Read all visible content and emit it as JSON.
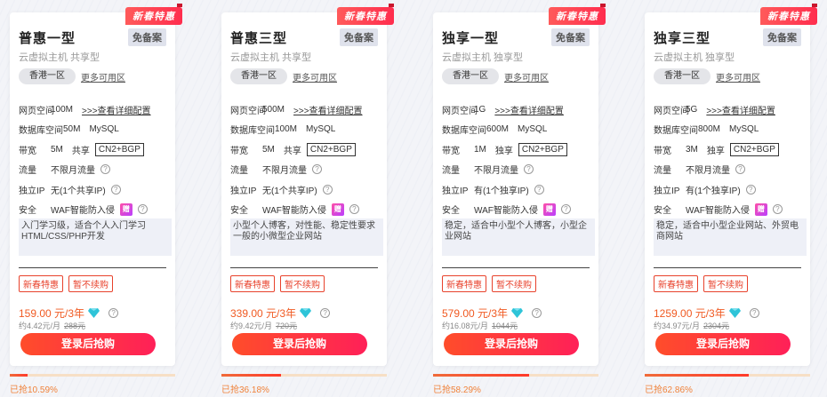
{
  "cards": [
    {
      "badge": "新春特惠",
      "title": "普惠一型",
      "free_tag": "免备案",
      "subtitle": "云虚拟主机 共享型",
      "region": "香港一区",
      "more_region": "更多可用区",
      "web_space_label": "网页空间",
      "web_space": "100M",
      "detail_link": ">>>查看详细配置",
      "db_label": "数据库空间",
      "db_space": "50M",
      "db_type": "MySQL",
      "bw_label": "带宽",
      "bandwidth": "5M",
      "bw_type": "共享",
      "line": "CN2+BGP",
      "traffic_label": "流量",
      "traffic": "不限月流量",
      "ip_label": "独立IP",
      "ip": "无(1个共享IP)",
      "security_label": "安全",
      "security": "WAF智能防入侵",
      "gift": "赠",
      "desc": "入门学习级，适合个人入门学习HTML/CSS/PHP开发",
      "tags": [
        "新春特惠",
        "暂不续购"
      ],
      "price": "159.00 元/3年",
      "monthly": "约4.42元/月",
      "old_price": "288元",
      "buy_label": "登录后抢购",
      "progress_text": "已抢10.59%",
      "progress": 0.1059
    },
    {
      "badge": "新春特惠",
      "title": "普惠三型",
      "free_tag": "免备案",
      "subtitle": "云虚拟主机 共享型",
      "region": "香港一区",
      "more_region": "更多可用区",
      "web_space_label": "网页空间",
      "web_space": "500M",
      "detail_link": ">>>查看详细配置",
      "db_label": "数据库空间",
      "db_space": "100M",
      "db_type": "MySQL",
      "bw_label": "带宽",
      "bandwidth": "5M",
      "bw_type": "共享",
      "line": "CN2+BGP",
      "traffic_label": "流量",
      "traffic": "不限月流量",
      "ip_label": "独立IP",
      "ip": "无(1个共享IP)",
      "security_label": "安全",
      "security": "WAF智能防入侵",
      "gift": "赠",
      "desc": "小型个人博客，对性能、稳定性要求一般的小微型企业网站",
      "tags": [
        "新春特惠",
        "暂不续购"
      ],
      "price": "339.00 元/3年",
      "monthly": "约9.42元/月",
      "old_price": "720元",
      "buy_label": "登录后抢购",
      "progress_text": "已抢36.18%",
      "progress": 0.3618
    },
    {
      "badge": "新春特惠",
      "title": "独享一型",
      "free_tag": "免备案",
      "subtitle": "云虚拟主机 独享型",
      "region": "香港一区",
      "more_region": "更多可用区",
      "web_space_label": "网页空间",
      "web_space": "1G",
      "detail_link": ">>>查看详细配置",
      "db_label": "数据库空间",
      "db_space": "600M",
      "db_type": "MySQL",
      "bw_label": "带宽",
      "bandwidth": "1M",
      "bw_type": "独享",
      "line": "CN2+BGP",
      "traffic_label": "流量",
      "traffic": "不限月流量",
      "ip_label": "独立IP",
      "ip": "有(1个独享IP)",
      "security_label": "安全",
      "security": "WAF智能防入侵",
      "gift": "赠",
      "desc": "稳定，适合中小型个人博客，小型企业网站",
      "tags": [
        "新春特惠",
        "暂不续购"
      ],
      "price": "579.00 元/3年",
      "monthly": "约16.08元/月",
      "old_price": "1044元",
      "buy_label": "登录后抢购",
      "progress_text": "已抢58.29%",
      "progress": 0.5829
    },
    {
      "badge": "新春特惠",
      "title": "独享三型",
      "free_tag": "免备案",
      "subtitle": "云虚拟主机 独享型",
      "region": "香港一区",
      "more_region": "更多可用区",
      "web_space_label": "网页空间",
      "web_space": "5G",
      "detail_link": ">>>查看详细配置",
      "db_label": "数据库空间",
      "db_space": "800M",
      "db_type": "MySQL",
      "bw_label": "带宽",
      "bandwidth": "3M",
      "bw_type": "独享",
      "line": "CN2+BGP",
      "traffic_label": "流量",
      "traffic": "不限月流量",
      "ip_label": "独立IP",
      "ip": "有(1个独享IP)",
      "security_label": "安全",
      "security": "WAF智能防入侵",
      "gift": "赠",
      "desc": "稳定，适合中小型企业网站、外贸电商网站",
      "tags": [
        "新春特惠",
        "暂不续购"
      ],
      "price": "1259.00 元/3年",
      "monthly": "约34.97元/月",
      "old_price": "2304元",
      "buy_label": "登录后抢购",
      "progress_text": "已抢62.86%",
      "progress": 0.6286
    }
  ],
  "colors": {
    "accent": "#f05a22",
    "button_start": "#ff4d2a",
    "button_end": "#ff2058",
    "badge": "#ff2d4e",
    "progress_track": "#f7dfc6"
  }
}
